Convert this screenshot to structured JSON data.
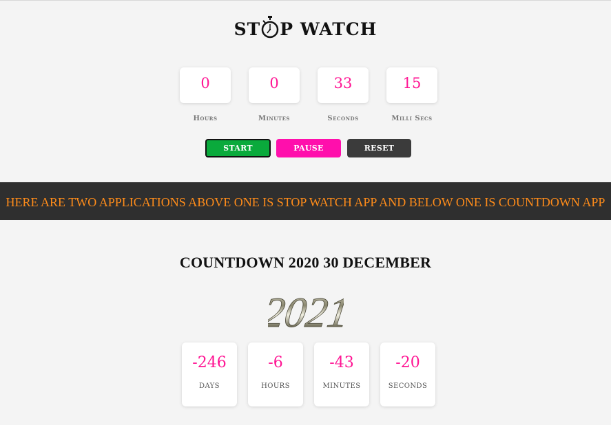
{
  "stopwatch": {
    "title_before": "ST",
    "title_after": "P WATCH",
    "units": [
      {
        "value": "0",
        "label": "Hours"
      },
      {
        "value": "0",
        "label": "Minutes"
      },
      {
        "value": "33",
        "label": "Seconds"
      },
      {
        "value": "15",
        "label": "Milli Secs"
      }
    ],
    "buttons": {
      "start": "START",
      "pause": "PAUSE",
      "reset": "RESET"
    }
  },
  "banner": {
    "text": "HERE ARE TWO APPLICATIONS ABOVE ONE IS STOP WATCH APP AND BELOW ONE IS COUNTDOWN APP"
  },
  "countdown": {
    "title": "COUNTDOWN 2020 30 DECEMBER",
    "year": "2021",
    "units": [
      {
        "value": "-246",
        "label": "DAYS"
      },
      {
        "value": "-6",
        "label": "HOURS"
      },
      {
        "value": "-43",
        "label": "MINUTES"
      },
      {
        "value": "-20",
        "label": "SECONDS"
      }
    ]
  },
  "colors": {
    "accent_pink": "#ff1493",
    "start_green": "#0aaa3c",
    "pause_pink": "#ff0fac",
    "reset_gray": "#3b3b3b",
    "banner_bg": "#2f2f2f",
    "banner_text": "#ff8c1a"
  },
  "icons": [
    "stopwatch-icon"
  ]
}
